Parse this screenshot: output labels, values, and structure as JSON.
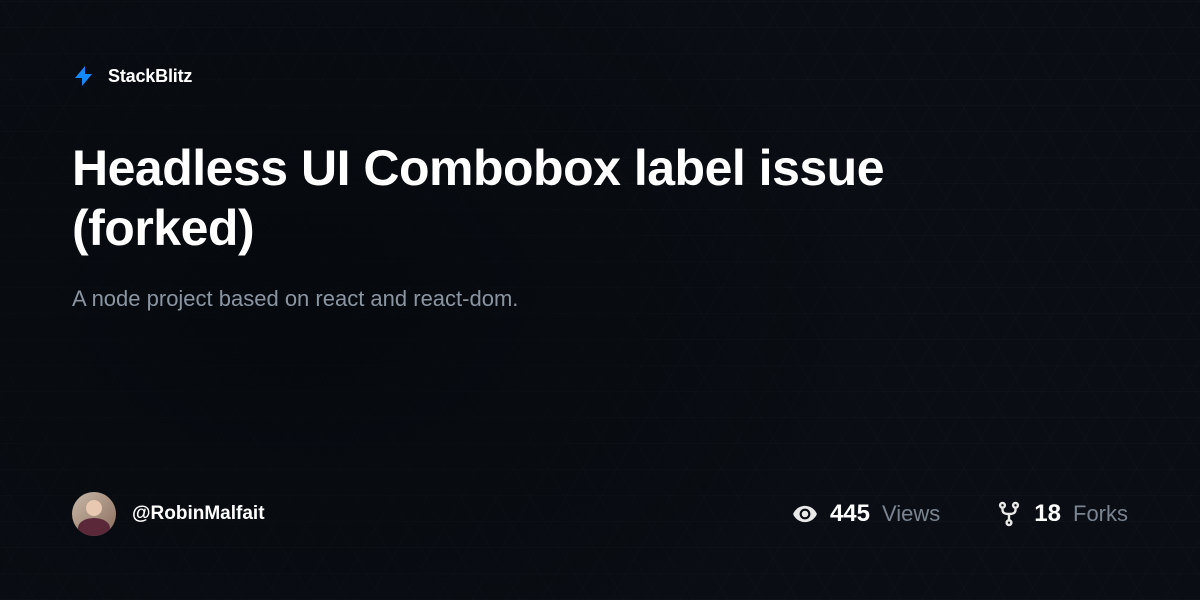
{
  "brand": {
    "name": "StackBlitz",
    "icon": "bolt-icon"
  },
  "project": {
    "title": "Headless UI Combobox label issue (forked)",
    "description": "A node project based on react and react-dom."
  },
  "author": {
    "username": "@RobinMalfait"
  },
  "stats": {
    "views": {
      "count": "445",
      "label": "Views"
    },
    "forks": {
      "count": "18",
      "label": "Forks"
    }
  }
}
